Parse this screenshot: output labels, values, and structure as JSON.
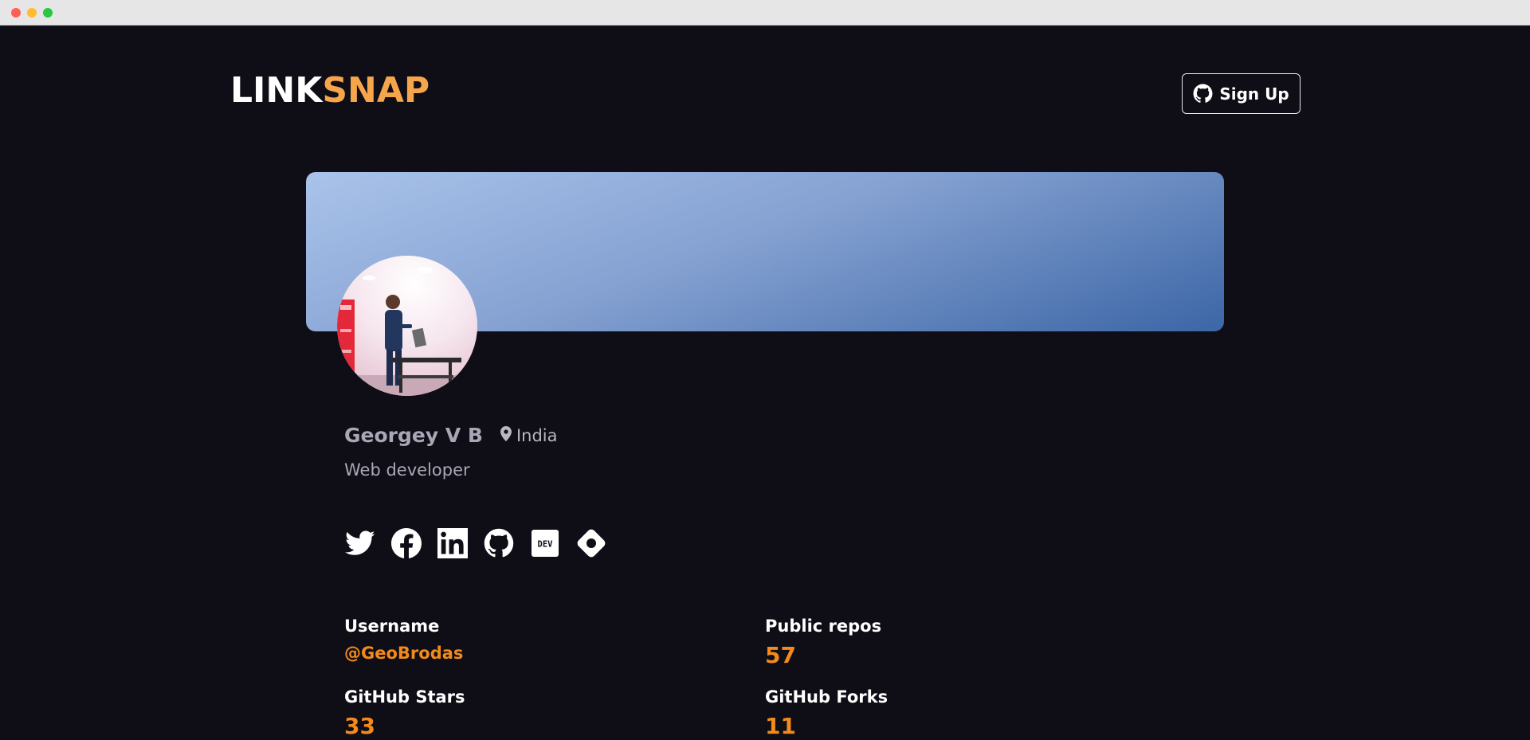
{
  "window": {
    "controls": [
      "close",
      "minimize",
      "maximize"
    ]
  },
  "header": {
    "logo_part_a": "LINK",
    "logo_part_b": "SNAP",
    "signup_label": "Sign Up",
    "signup_icon": "github-icon"
  },
  "colors": {
    "background": "#0f0d15",
    "accent": "#f28a1c",
    "logo_accent": "#f7a54a",
    "banner_top": "#a9c3ea",
    "banner_bottom": "#3c66a6"
  },
  "profile": {
    "name": "Georgey V B",
    "location": "India",
    "location_icon": "map-pin-icon",
    "bio": "Web developer",
    "avatar": "profile-photo"
  },
  "socials": [
    {
      "name": "twitter",
      "icon": "twitter-icon"
    },
    {
      "name": "facebook",
      "icon": "facebook-icon"
    },
    {
      "name": "linkedin",
      "icon": "linkedin-icon"
    },
    {
      "name": "github",
      "icon": "github-icon"
    },
    {
      "name": "dev",
      "icon": "dev-icon",
      "text": "DEV"
    },
    {
      "name": "hashnode",
      "icon": "hashnode-icon"
    }
  ],
  "stats": {
    "username_label": "Username",
    "username_value": "@GeoBrodas",
    "repos_label": "Public repos",
    "repos_value": "57",
    "stars_label": "GitHub Stars",
    "stars_value": "33",
    "forks_label": "GitHub Forks",
    "forks_value": "11"
  }
}
